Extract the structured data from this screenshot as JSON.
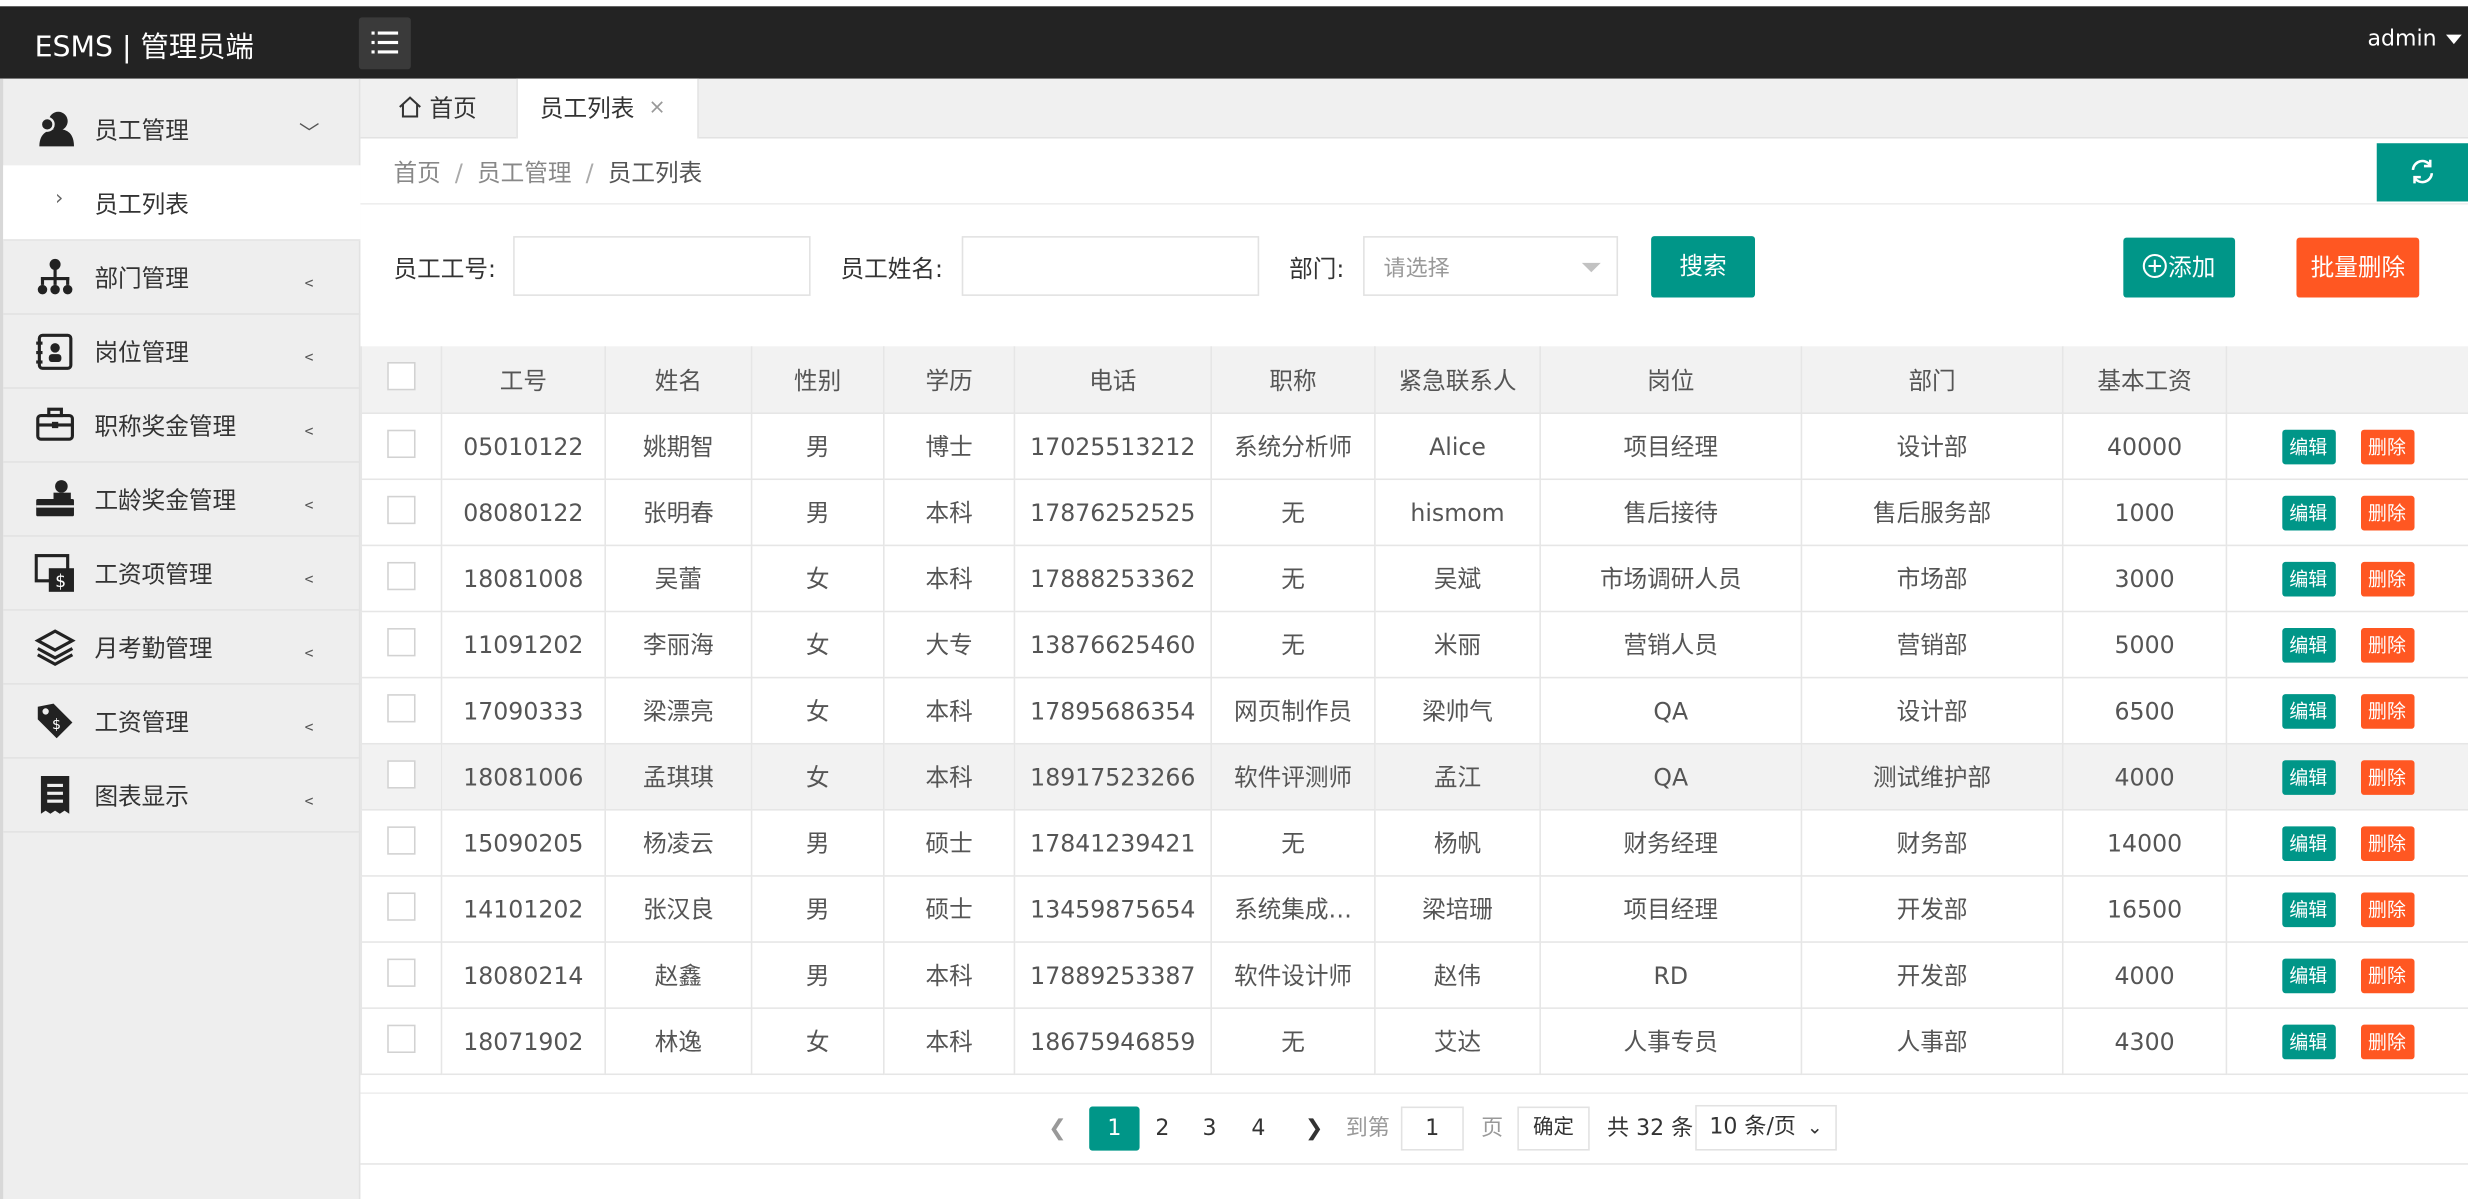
{
  "app": {
    "title": "ESMS | 管理员端",
    "user": "admin"
  },
  "sidebar": {
    "items": [
      {
        "label": "员工管理",
        "icon": "users-icon",
        "arrow": "﹀"
      },
      {
        "label": "部门管理",
        "icon": "org-chart-icon",
        "arrow": "﹤"
      },
      {
        "label": "岗位管理",
        "icon": "badge-icon",
        "arrow": "﹤"
      },
      {
        "label": "职称奖金管理",
        "icon": "briefcase-icon",
        "arrow": "﹤"
      },
      {
        "label": "工龄奖金管理",
        "icon": "worker-icon",
        "arrow": "﹤"
      },
      {
        "label": "工资项管理",
        "icon": "salary-item-icon",
        "arrow": "﹤"
      },
      {
        "label": "月考勤管理",
        "icon": "layers-icon",
        "arrow": "﹤"
      },
      {
        "label": "工资管理",
        "icon": "price-tag-icon",
        "arrow": "﹤"
      },
      {
        "label": "图表显示",
        "icon": "receipt-icon",
        "arrow": "﹤"
      }
    ],
    "sub_item": "员工列表"
  },
  "tabs": {
    "home": "首页",
    "active": "员工列表",
    "close": "×"
  },
  "breadcrumb": {
    "first": "首页",
    "second": "员工管理",
    "third": "员工列表",
    "sep": "/"
  },
  "filters": {
    "id_label": "员工工号:",
    "name_label": "员工姓名:",
    "dept_label": "部门:",
    "dept_placeholder": "请选择",
    "search_label": "搜索",
    "add_label": "添加",
    "batch_delete_label": "批量删除"
  },
  "table": {
    "headers": [
      "工号",
      "姓名",
      "性别",
      "学历",
      "电话",
      "职称",
      "紧急联系人",
      "岗位",
      "部门",
      "基本工资"
    ],
    "edit_label": "编辑",
    "delete_label": "删除",
    "rows": [
      [
        "05010122",
        "姚期智",
        "男",
        "博士",
        "17025513212",
        "系统分析师",
        "Alice",
        "项目经理",
        "设计部",
        "40000"
      ],
      [
        "08080122",
        "张明春",
        "男",
        "本科",
        "17876252525",
        "无",
        "hismom",
        "售后接待",
        "售后服务部",
        "1000"
      ],
      [
        "18081008",
        "吴蕾",
        "女",
        "本科",
        "17888253362",
        "无",
        "吴斌",
        "市场调研人员",
        "市场部",
        "3000"
      ],
      [
        "11091202",
        "李丽海",
        "女",
        "大专",
        "13876625460",
        "无",
        "米丽",
        "营销人员",
        "营销部",
        "5000"
      ],
      [
        "17090333",
        "梁漂亮",
        "女",
        "本科",
        "17895686354",
        "网页制作员",
        "梁帅气",
        "QA",
        "设计部",
        "6500"
      ],
      [
        "18081006",
        "孟琪琪",
        "女",
        "本科",
        "18917523266",
        "软件评测师",
        "孟江",
        "QA",
        "测试维护部",
        "4000"
      ],
      [
        "15090205",
        "杨凌云",
        "男",
        "硕士",
        "17841239421",
        "无",
        "杨帆",
        "财务经理",
        "财务部",
        "14000"
      ],
      [
        "14101202",
        "张汉良",
        "男",
        "硕士",
        "13459875654",
        "系统集成…",
        "梁培珊",
        "项目经理",
        "开发部",
        "16500"
      ],
      [
        "18080214",
        "赵鑫",
        "男",
        "本科",
        "17889253387",
        "软件设计师",
        "赵伟",
        "RD",
        "开发部",
        "4000"
      ],
      [
        "18071902",
        "林逸",
        "女",
        "本科",
        "18675946859",
        "无",
        "艾达",
        "人事专员",
        "人事部",
        "4300"
      ]
    ]
  },
  "pagination": {
    "pages": [
      "1",
      "2",
      "3",
      "4"
    ],
    "current": "1",
    "goto_label": "到第",
    "goto_value": "1",
    "page_label": "页",
    "confirm_label": "确定",
    "total_label": "共 32 条",
    "page_size": "10 条/页"
  },
  "colors": {
    "primary": "#009688",
    "danger": "#ff5722",
    "topbar": "#232323"
  }
}
